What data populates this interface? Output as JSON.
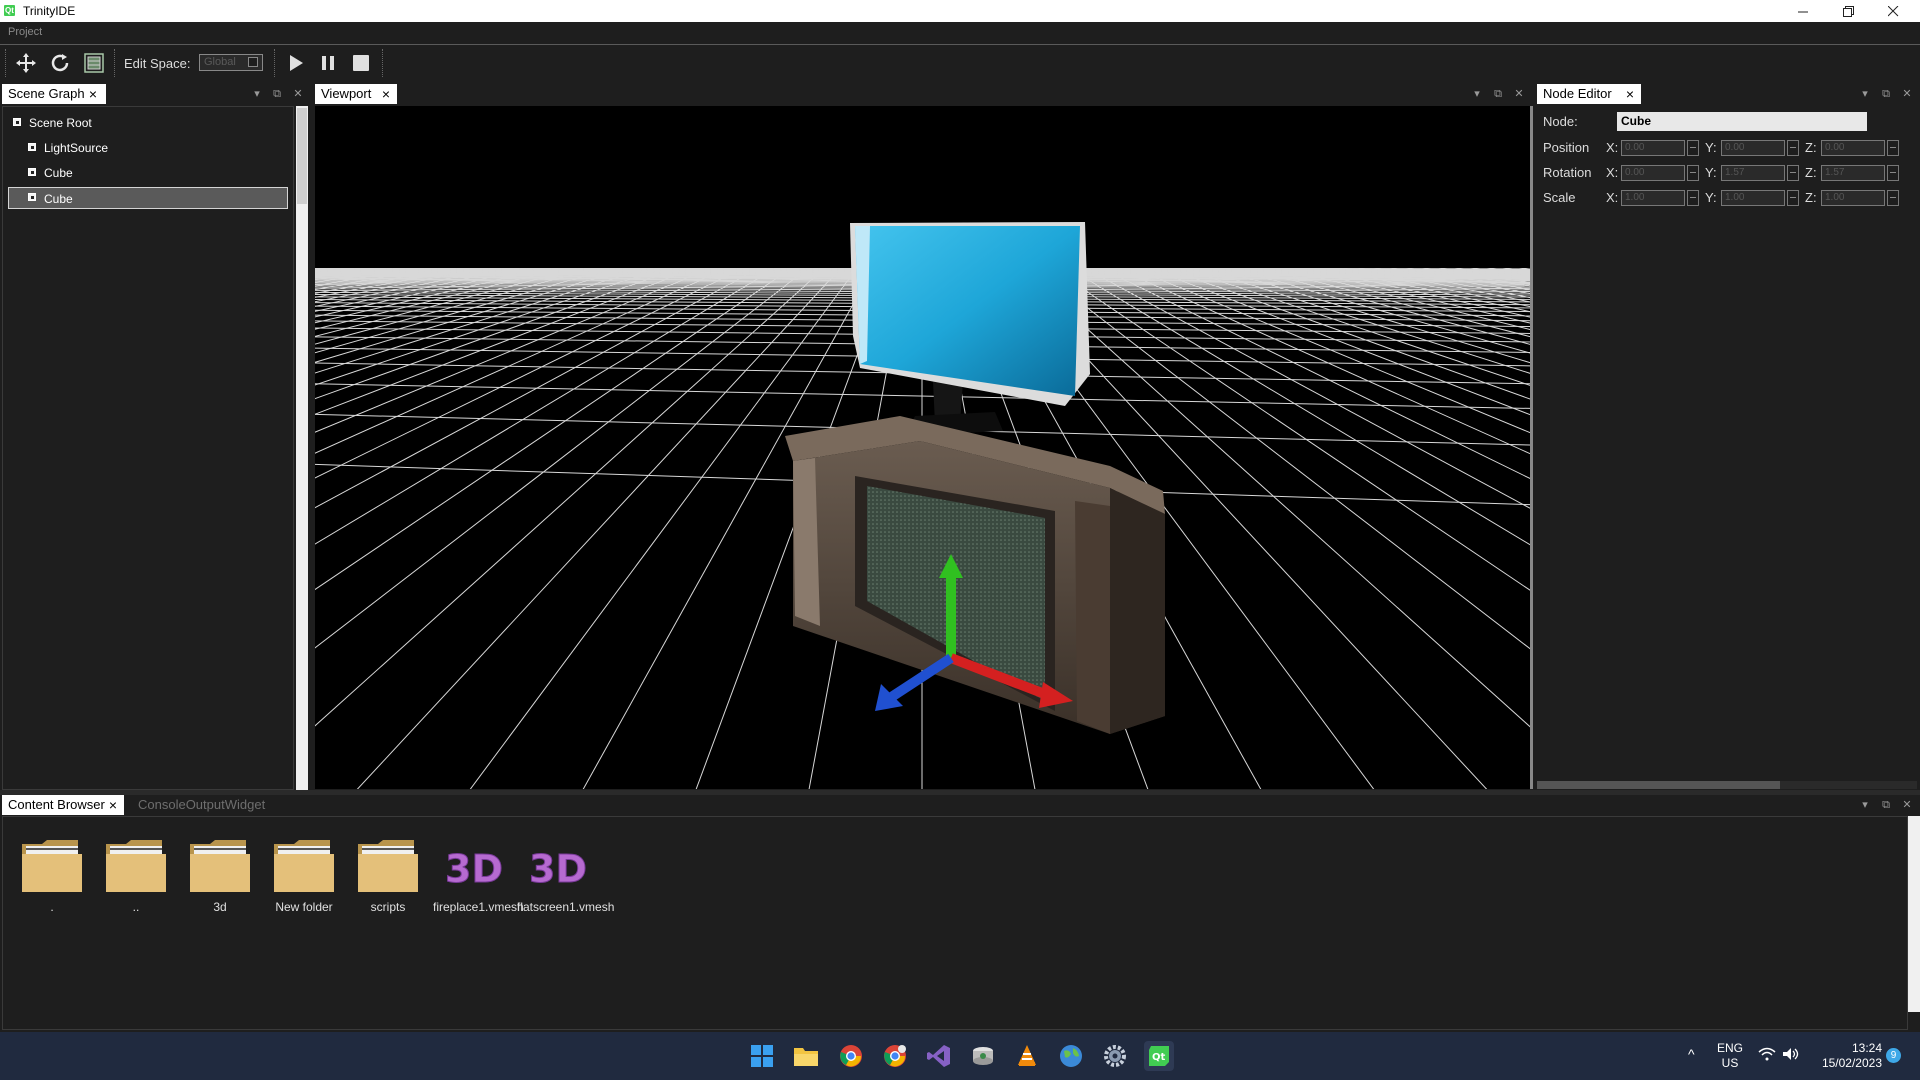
{
  "window": {
    "title": "TrinityIDE",
    "app_icon_text": "Qt"
  },
  "menu": {
    "items": [
      "Project"
    ]
  },
  "toolbar": {
    "edit_space_label": "Edit Space:",
    "edit_space_value": "Global",
    "tools": [
      "move-icon",
      "rotate-icon",
      "scale-icon"
    ],
    "playback": [
      "play-icon",
      "pause-icon",
      "stop-icon"
    ]
  },
  "docks": {
    "scene_graph": {
      "title": "Scene Graph"
    },
    "viewport": {
      "title": "Viewport"
    },
    "node_editor": {
      "title": "Node Editor"
    },
    "content_browser": {
      "title": "Content Browser"
    },
    "console": {
      "title": "ConsoleOutputWidget"
    }
  },
  "scene_graph": {
    "items": [
      {
        "label": "Scene Root"
      },
      {
        "label": "LightSource"
      },
      {
        "label": "Cube"
      },
      {
        "label": "Cube"
      }
    ],
    "selected_index": 3
  },
  "node_editor": {
    "node_label": "Node:",
    "node_value": "Cube",
    "rows": [
      {
        "label": "Position",
        "x": "0.00",
        "y": "0.00",
        "z": "0.00"
      },
      {
        "label": "Rotation",
        "x": "0.00",
        "y": "1.57",
        "z": "1.57"
      },
      {
        "label": "Scale",
        "x": "1.00",
        "y": "1.00",
        "z": "1.00"
      }
    ],
    "axes": [
      "X:",
      "Y:",
      "Z:"
    ]
  },
  "content_browser": {
    "items": [
      {
        "label": ".",
        "kind": "folder"
      },
      {
        "label": "..",
        "kind": "folder"
      },
      {
        "label": "3d",
        "kind": "folder"
      },
      {
        "label": "New folder",
        "kind": "folder"
      },
      {
        "label": "scripts",
        "kind": "folder"
      },
      {
        "label": "fireplace1.vmesh",
        "kind": "mesh"
      },
      {
        "label": "flatscreen1.vmesh",
        "kind": "mesh"
      }
    ]
  },
  "taskbar": {
    "apps": [
      "windows-start-icon",
      "file-explorer-icon",
      "chrome-icon",
      "chrome-canary-icon",
      "visual-studio-icon",
      "disk-app-icon",
      "vlc-icon",
      "globe-app-icon",
      "settings-icon",
      "qt-creator-icon"
    ],
    "language_line1": "ENG",
    "language_line2": "US",
    "time": "13:24",
    "date": "15/02/2023",
    "notification_count": "9"
  },
  "colors": {
    "background": "#1e1e1e",
    "taskbar": "#202a3f",
    "gizmo_x": "#d42020",
    "gizmo_y": "#30c020",
    "gizmo_z": "#2050d0",
    "screen": "#1ea6d8"
  }
}
